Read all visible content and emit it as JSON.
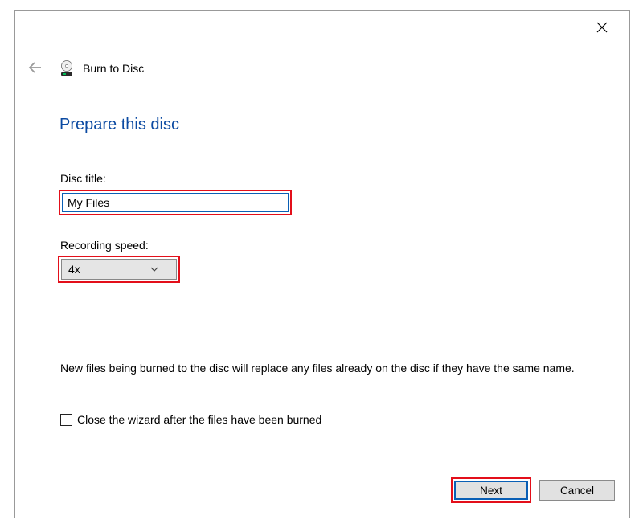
{
  "window": {
    "title": "Burn to Disc"
  },
  "heading": "Prepare this disc",
  "labels": {
    "disc_title": "Disc title:",
    "recording_speed": "Recording speed:"
  },
  "fields": {
    "disc_title_value": "My Files",
    "recording_speed_value": "4x"
  },
  "note": "New files being burned to the disc will replace any files already on the disc if they have the same name.",
  "checkbox": {
    "close_after_burn_label": "Close the wizard after the files have been burned",
    "close_after_burn_checked": false
  },
  "buttons": {
    "next": "Next",
    "cancel": "Cancel"
  }
}
